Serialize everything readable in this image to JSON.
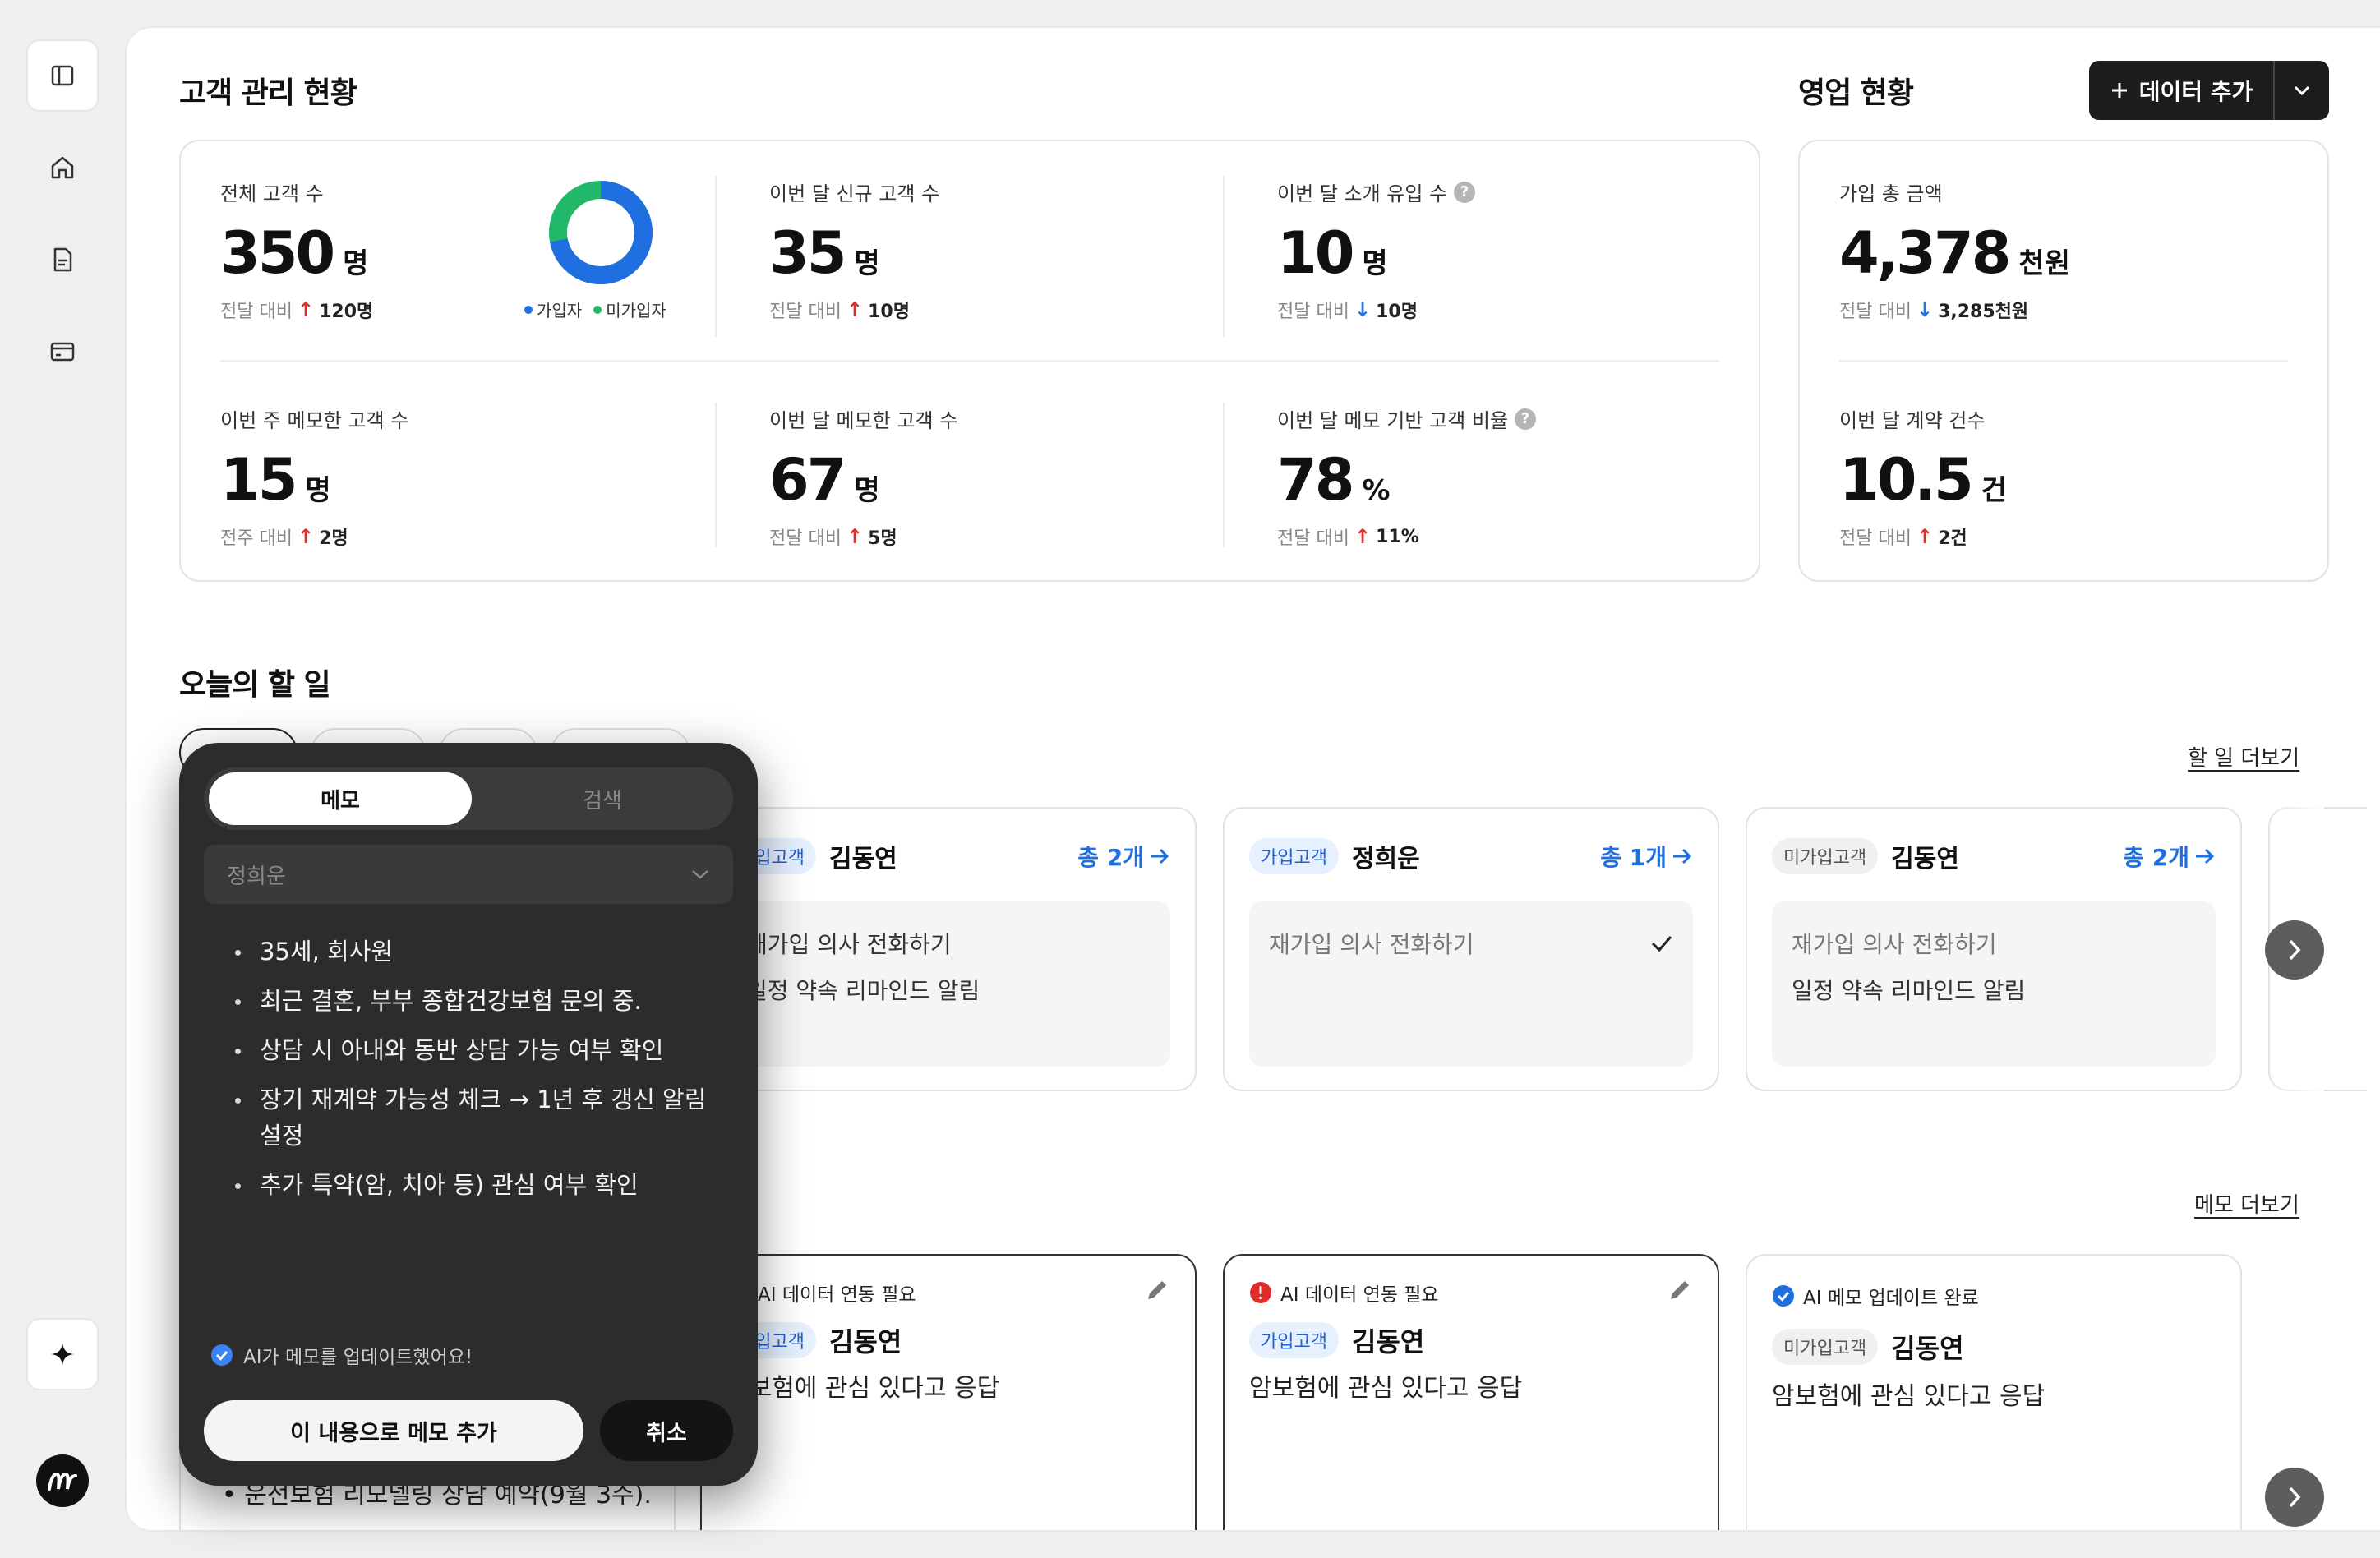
{
  "colors": {
    "accent": "#1f6fe0",
    "up": "#e22c2c",
    "down": "#2673e8",
    "donut_joined": "#1f6fe0",
    "donut_not_joined": "#22b86a"
  },
  "sidebar": {
    "icons": [
      "sidebar-toggle-icon",
      "home-icon",
      "document-icon",
      "card-icon"
    ],
    "ai_icon": "sparkle-icon",
    "logo": "m"
  },
  "header": {
    "customer_title": "고객 관리 현황",
    "sales_title": "영업 현황",
    "add_data_label": "데이터 추가"
  },
  "customer_stats": [
    {
      "label": "전체 고객 수",
      "value": "350",
      "unit": "명",
      "compare": "전달 대비",
      "direction": "up",
      "delta": "120명",
      "help": false
    },
    {
      "label": "이번 달 신규 고객 수",
      "value": "35",
      "unit": "명",
      "compare": "전달 대비",
      "direction": "up",
      "delta": "10명",
      "help": false
    },
    {
      "label": "이번 달 소개 유입 수",
      "value": "10",
      "unit": "명",
      "compare": "전달 대비",
      "direction": "down",
      "delta": "10명",
      "help": true
    },
    {
      "label": "이번 주 메모한 고객 수",
      "value": "15",
      "unit": "명",
      "compare": "전주 대비",
      "direction": "up",
      "delta": "2명",
      "help": false
    },
    {
      "label": "이번 달 메모한 고객 수",
      "value": "67",
      "unit": "명",
      "compare": "전달 대비",
      "direction": "up",
      "delta": "5명",
      "help": false
    },
    {
      "label": "이번 달 메모 기반 고객 비율",
      "value": "78",
      "unit": "%",
      "compare": "전달 대비",
      "direction": "up",
      "delta": "11%",
      "help": true
    }
  ],
  "donut": {
    "legend_joined": "가입자",
    "legend_not_joined": "미가입자",
    "joined_fraction": 0.72
  },
  "sales_stats": [
    {
      "label": "가입 총 금액",
      "value": "4,378",
      "unit": "천원",
      "compare": "전달 대비",
      "direction": "down",
      "delta": "3,285천원"
    },
    {
      "label": "이번 달 계약 건수",
      "value": "10.5",
      "unit": "건",
      "compare": "전달 대비",
      "direction": "up",
      "delta": "2건"
    }
  ],
  "todo": {
    "title": "오늘의 할 일",
    "more_link": "할 일 더보기",
    "cards": [
      {
        "badge": "가입고객",
        "badge_type": "join",
        "name": "김동연",
        "total": "총 2개",
        "tasks": [
          {
            "text": "재가입 의사 전화하기",
            "done": false
          },
          {
            "text": "일정 약속 리마인드 알림",
            "done": false
          }
        ]
      },
      {
        "badge": "가입고객",
        "badge_type": "join",
        "name": "정희운",
        "total": "총 1개",
        "tasks": [
          {
            "text": "재가입 의사 전화하기",
            "done": true
          }
        ]
      },
      {
        "badge": "미가입고객",
        "badge_type": "nojoin",
        "name": "김동연",
        "total": "총 2개",
        "tasks": [
          {
            "text": "재가입 의사 전화하기",
            "done": false
          },
          {
            "text": "일정 약속 리마인드 알림",
            "done": false
          }
        ]
      }
    ]
  },
  "memo": {
    "more_link": "메모 더보기",
    "cards": [
      {
        "status": "AI 데이터 연동 필요",
        "status_type": "error",
        "badge": "가입고객",
        "badge_type": "join",
        "name": "김동연",
        "text": "암보험에 관심 있다고 응답"
      },
      {
        "status": "AI 데이터 연동 필요",
        "status_type": "error",
        "badge": "가입고객",
        "badge_type": "join",
        "name": "김동연",
        "text": "암보험에 관심 있다고 응답"
      },
      {
        "status": "AI 메모 업데이트 완료",
        "status_type": "ok",
        "badge": "미가입고객",
        "badge_type": "nojoin",
        "name": "김동연",
        "text": "암보험에 관심 있다고 응답"
      }
    ],
    "behind_text": "• 운전보험 리모델링 상담 예약(9월 3주)."
  },
  "popover": {
    "tab_memo": "메모",
    "tab_search": "검색",
    "customer": "정희운",
    "bullets": [
      "35세, 회사원",
      "최근 결혼, 부부 종합건강보험 문의 중.",
      "상담 시 아내와 동반 상담 가능 여부 확인",
      "장기 재계약 가능성 체크 → 1년 후 갱신 알림 설정",
      "추가 특약(암, 치아 등) 관심 여부 확인"
    ],
    "ai_note": "AI가 메모를 업데이트했어요!",
    "confirm_label": "이 내용으로 메모 추가",
    "cancel_label": "취소"
  }
}
